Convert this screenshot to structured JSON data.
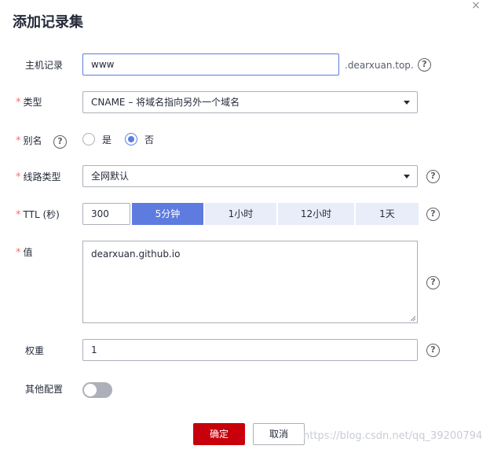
{
  "dialog": {
    "title": "添加记录集",
    "close_icon": "×"
  },
  "form": {
    "host": {
      "label": "主机记录",
      "value": "www",
      "suffix": ".dearxuan.top."
    },
    "type": {
      "label": "类型",
      "value": "CNAME – 将域名指向另外一个域名"
    },
    "alias": {
      "label": "别名",
      "options": [
        "是",
        "否"
      ],
      "selected": "否"
    },
    "line_type": {
      "label": "线路类型",
      "value": "全网默认"
    },
    "ttl": {
      "label": "TTL (秒)",
      "value": "300",
      "presets": [
        "5分钟",
        "1小时",
        "12小时",
        "1天"
      ],
      "active_preset": "5分钟"
    },
    "value": {
      "label": "值",
      "content": "dearxuan.github.io"
    },
    "weight": {
      "label": "权重",
      "value": "1"
    },
    "other_config": {
      "label": "其他配置",
      "enabled": false
    }
  },
  "required_mark": "*",
  "help_glyph": "?",
  "footer": {
    "confirm_label": "确定",
    "cancel_label": "取消"
  },
  "watermark": "https://blog.csdn.net/qq_39200794",
  "colors": {
    "accent": "#5e7ce0",
    "primary_button": "#c7000b",
    "required": "#f66f6a"
  }
}
